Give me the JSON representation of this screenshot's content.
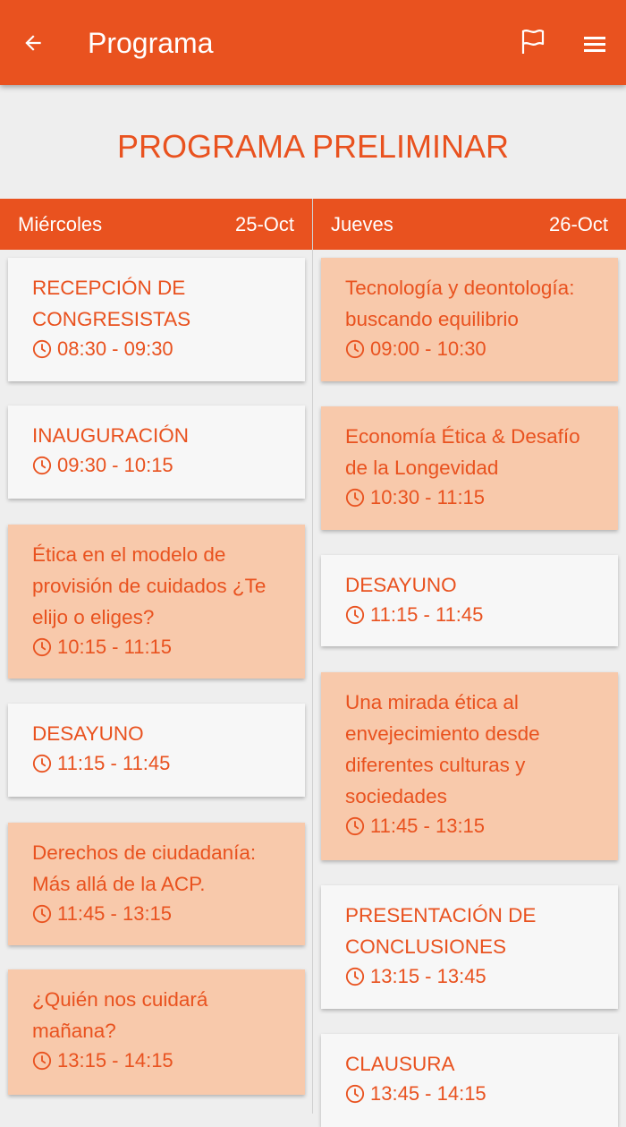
{
  "appbar": {
    "title": "Programa",
    "back_icon": "arrow-left-icon",
    "flag_icon": "flag-icon",
    "menu_icon": "menu-icon"
  },
  "heading": "PROGRAMA PRELIMINAR",
  "colors": {
    "accent": "#e9521f",
    "card": "#f7f7f7",
    "card_highlight": "#f8c9ab",
    "background": "#eeeeee"
  },
  "days": [
    {
      "name": "Miércoles",
      "date": "25-Oct",
      "events": [
        {
          "title": "RECEPCIÓN DE CONGRESISTAS",
          "time": "08:30 - 09:30",
          "highlight": false
        },
        {
          "title": "INAUGURACIÓN",
          "time": "09:30 - 10:15",
          "highlight": false
        },
        {
          "title": "Ética en el modelo de provisión de cuidados ¿Te elijo o eliges?",
          "time": "10:15 - 11:15",
          "highlight": true
        },
        {
          "title": "DESAYUNO",
          "time": "11:15 - 11:45",
          "highlight": false
        },
        {
          "title": "Derechos de ciudadanía: Más allá de la ACP.",
          "time": "11:45 - 13:15",
          "highlight": true
        },
        {
          "title": "¿Quién nos cuidará mañana?",
          "time": "13:15 - 14:15",
          "highlight": true
        }
      ]
    },
    {
      "name": "Jueves",
      "date": "26-Oct",
      "events": [
        {
          "title": "Tecnología y deontología: buscando equilibrio",
          "time": "09:00 - 10:30",
          "highlight": true
        },
        {
          "title": "Economía Ética & Desafío de la Longevidad",
          "time": "10:30 - 11:15",
          "highlight": true
        },
        {
          "title": "DESAYUNO",
          "time": "11:15 - 11:45",
          "highlight": false
        },
        {
          "title": "Una mirada ética al envejecimiento desde diferentes culturas y sociedades",
          "time": "11:45 - 13:15",
          "highlight": true
        },
        {
          "title": "PRESENTACIÓN DE CONCLUSIONES",
          "time": "13:15 - 13:45",
          "highlight": false
        },
        {
          "title": "CLAUSURA",
          "time": "13:45 - 14:15",
          "highlight": false
        }
      ]
    }
  ]
}
